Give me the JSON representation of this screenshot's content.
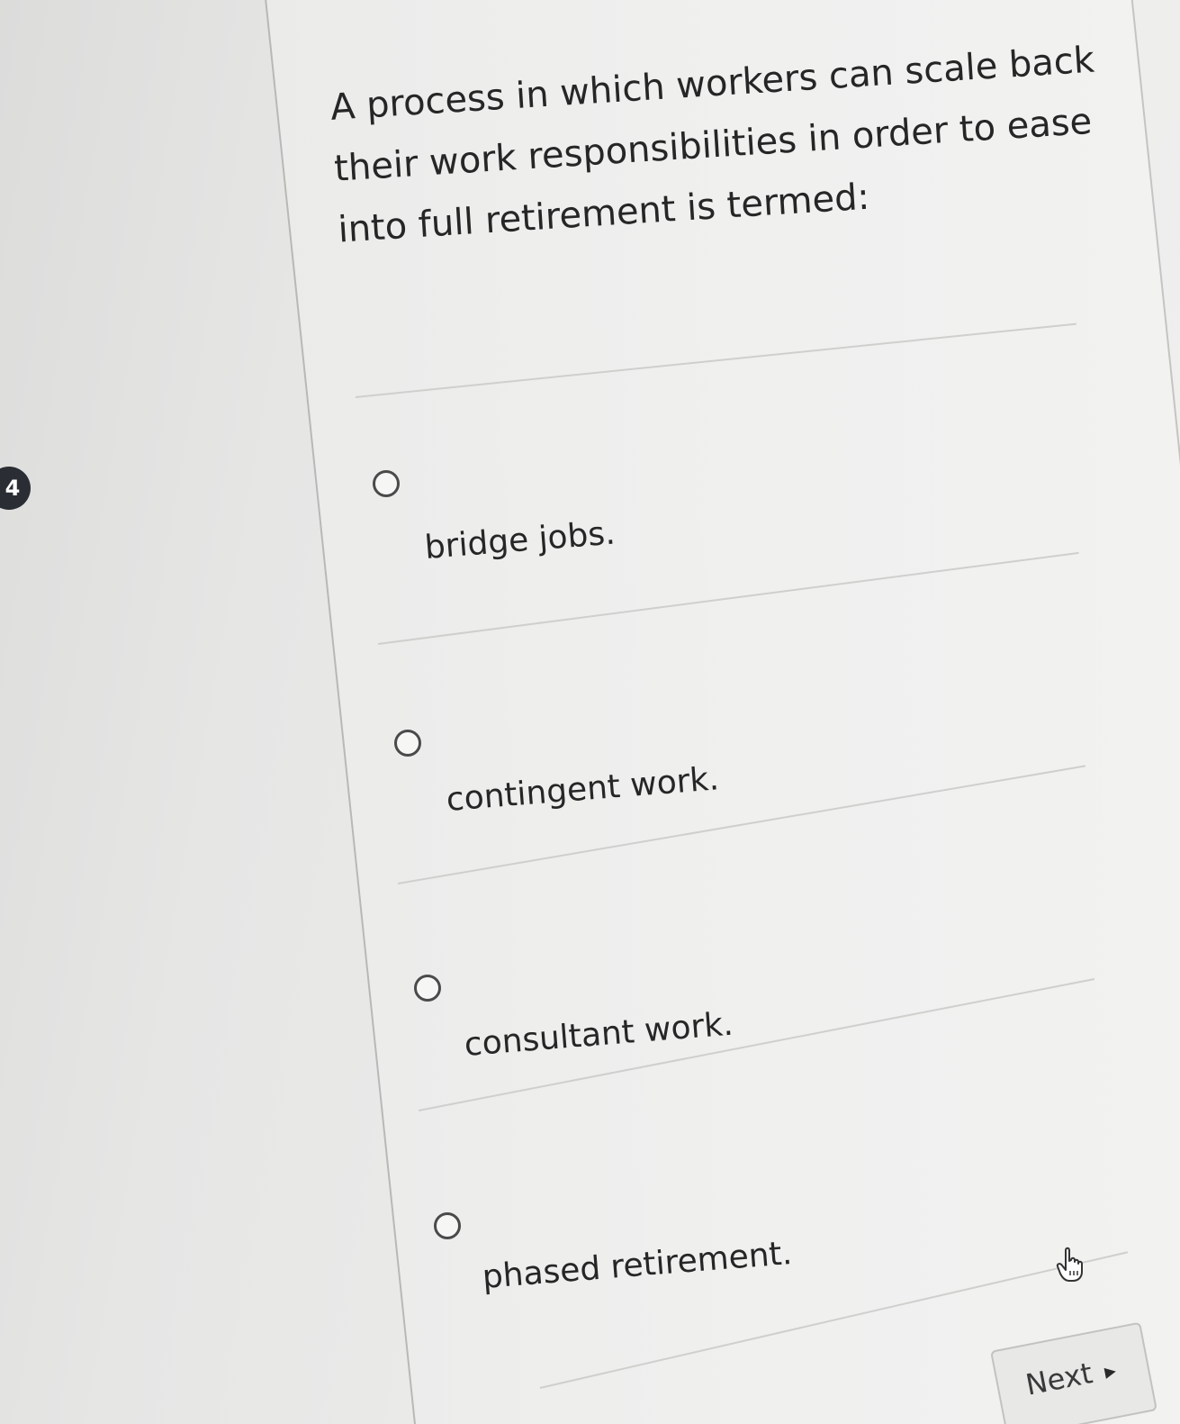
{
  "question": {
    "number": "4",
    "text": "A process in which workers can scale back their work responsibilities in order to ease into full retirement is termed:"
  },
  "options": [
    {
      "label": "bridge jobs."
    },
    {
      "label": "contingent work."
    },
    {
      "label": "consultant work."
    },
    {
      "label": "phased retirement."
    }
  ],
  "navigation": {
    "next_label": "Next",
    "next_icon": "triangle-right-icon"
  },
  "colors": {
    "card_background": "#f0f0ef",
    "text": "#262626",
    "badge_background": "#2a2d33"
  }
}
